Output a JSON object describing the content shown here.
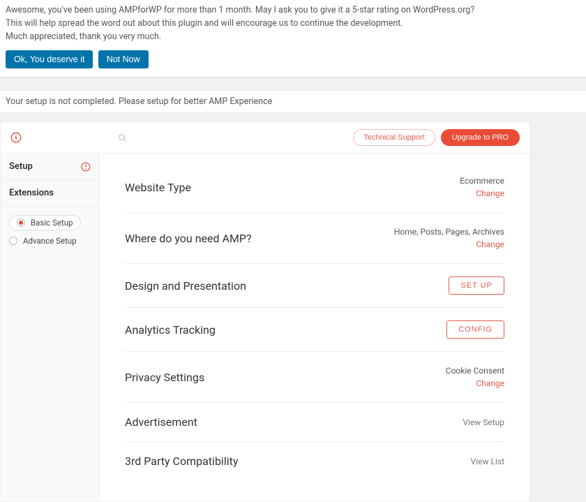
{
  "notice": {
    "line1": "Awesome, you've been using AMPforWP for more than 1 month. May I ask you to give it a 5-star rating on WordPress.org?",
    "line2": "This will help spread the word out about this plugin and will encourage us to continue the development.",
    "line3": "Much appreciated, thank you very much.",
    "ok": "Ok, You deserve it",
    "notnow": "Not Now"
  },
  "notice2": "Your setup is not completed. Please setup for better AMP Experience",
  "topbar": {
    "support": "Technical Support",
    "upgrade": "Upgrade to PRO"
  },
  "sidebar": {
    "setup": "Setup",
    "extensions": "Extensions",
    "radios": {
      "basic": "Basic Setup",
      "advance": "Advance Setup"
    }
  },
  "rows": {
    "website_type": {
      "title": "Website Type",
      "value": "Ecommerce",
      "change": "Change"
    },
    "need_amp": {
      "title": "Where do you need AMP?",
      "value": "Home, Posts, Pages, Archives",
      "change": "Change"
    },
    "design": {
      "title": "Design and Presentation",
      "action": "SET UP"
    },
    "analytics": {
      "title": "Analytics Tracking",
      "action": "CONFIG"
    },
    "privacy": {
      "title": "Privacy Settings",
      "value": "Cookie Consent",
      "change": "Change"
    },
    "ads": {
      "title": "Advertisement",
      "link": "View Setup"
    },
    "compat": {
      "title": "3rd Party Compatibility",
      "link": "View List"
    }
  }
}
